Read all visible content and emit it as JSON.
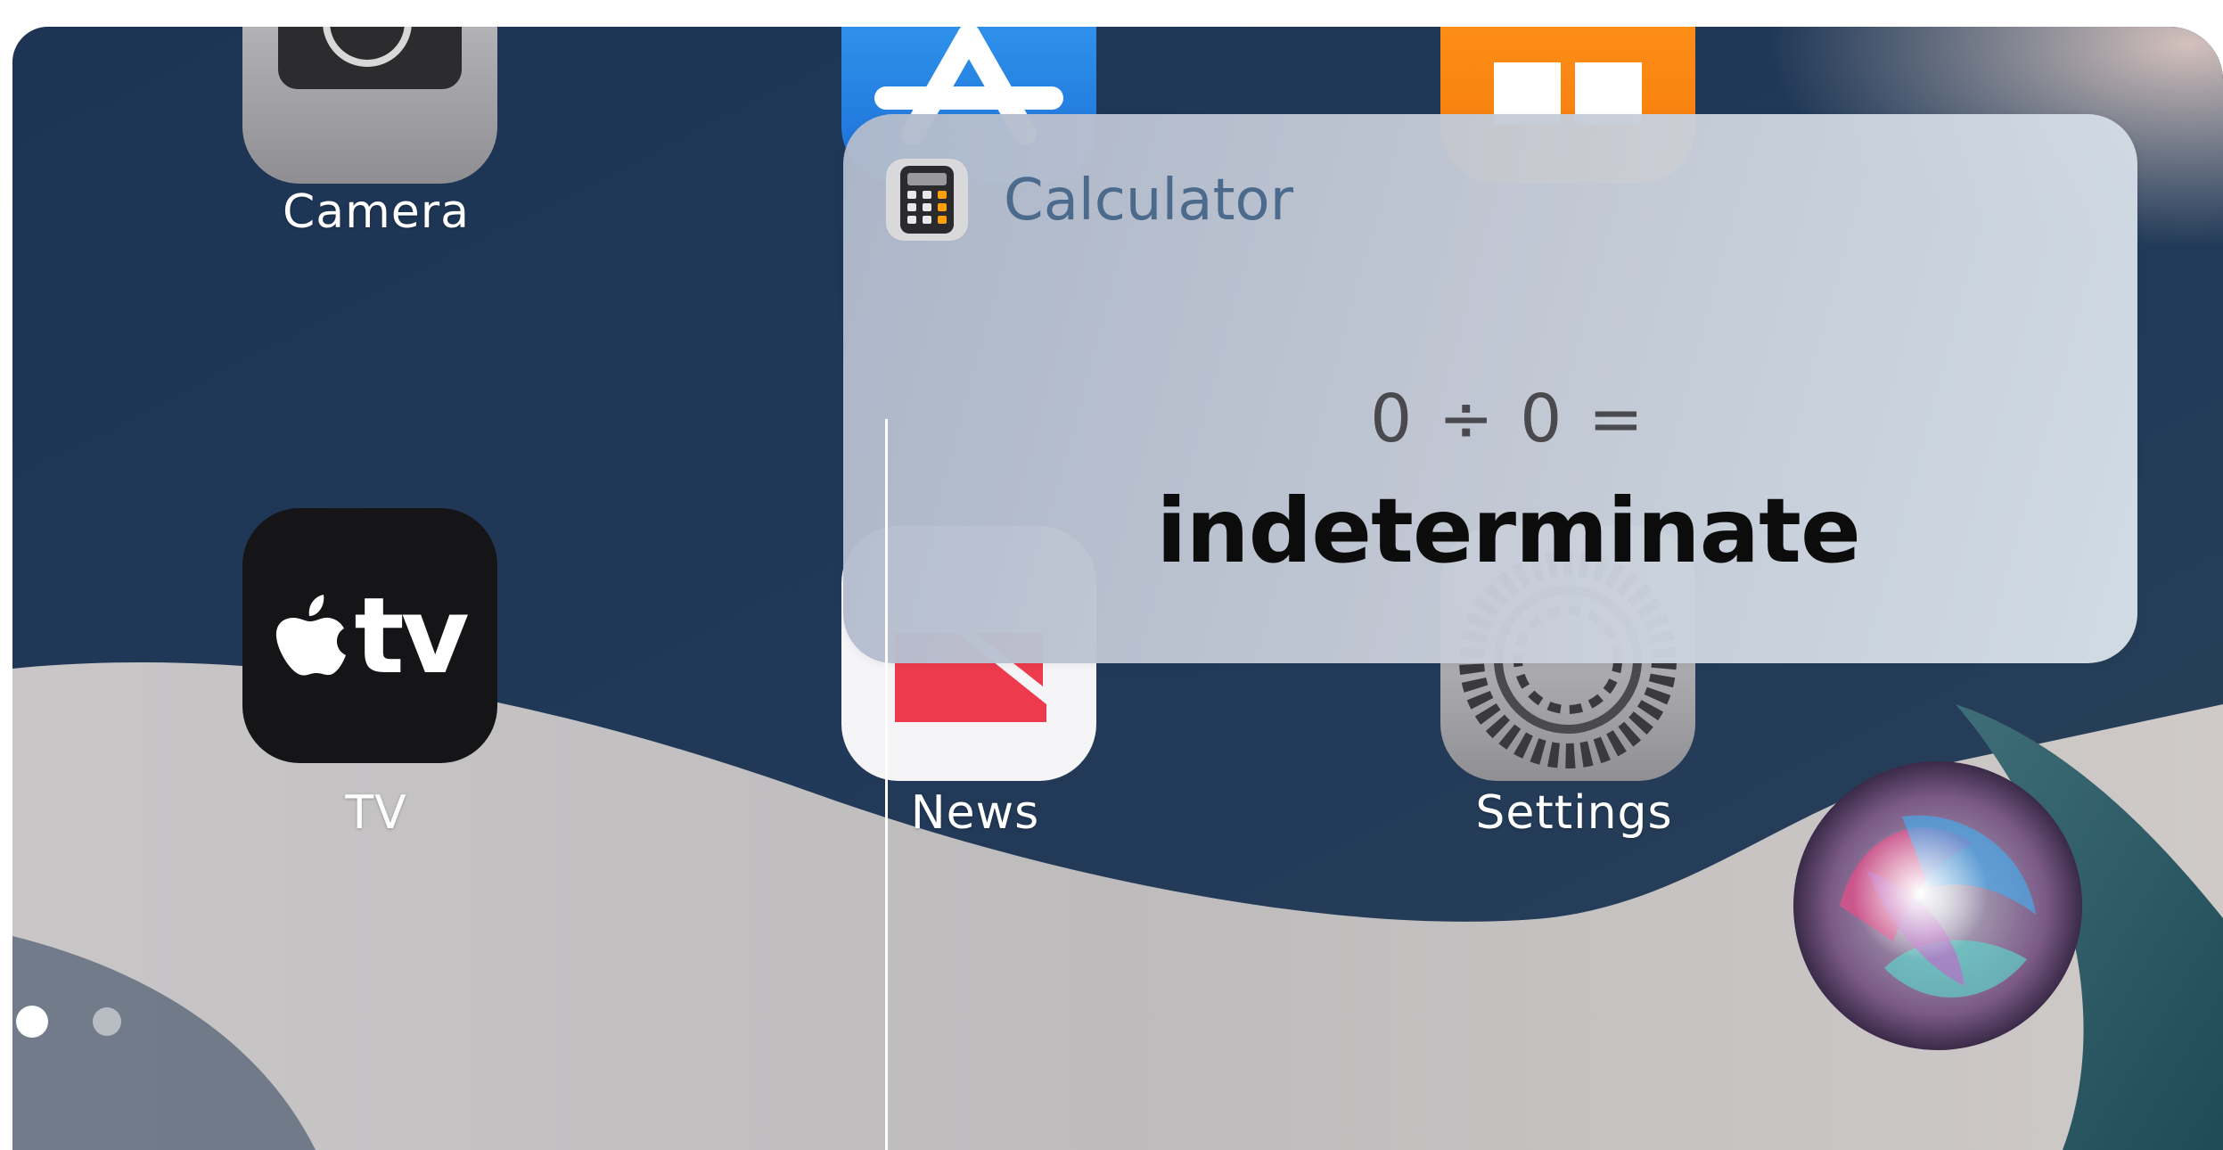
{
  "home_screen": {
    "apps": [
      {
        "id": "camera",
        "label": "Camera"
      },
      {
        "id": "app-store",
        "label": ""
      },
      {
        "id": "books",
        "label": ""
      },
      {
        "id": "tv",
        "label": "TV",
        "glyph": "tv"
      },
      {
        "id": "news",
        "label": "News"
      },
      {
        "id": "settings",
        "label": "Settings"
      }
    ],
    "page_dots": {
      "count": 2,
      "active_index": 0
    }
  },
  "siri_result": {
    "app_name": "Calculator",
    "expression": "0 ÷ 0 =",
    "result": "indeterminate"
  },
  "siri": {
    "icon": "siri-orb-icon"
  },
  "colors": {
    "wallpaper_dark": "#1f3450",
    "wallpaper_light": "#bdbbbd",
    "card_title": "#4c6a8c",
    "result_text": "#0c0c0c"
  }
}
